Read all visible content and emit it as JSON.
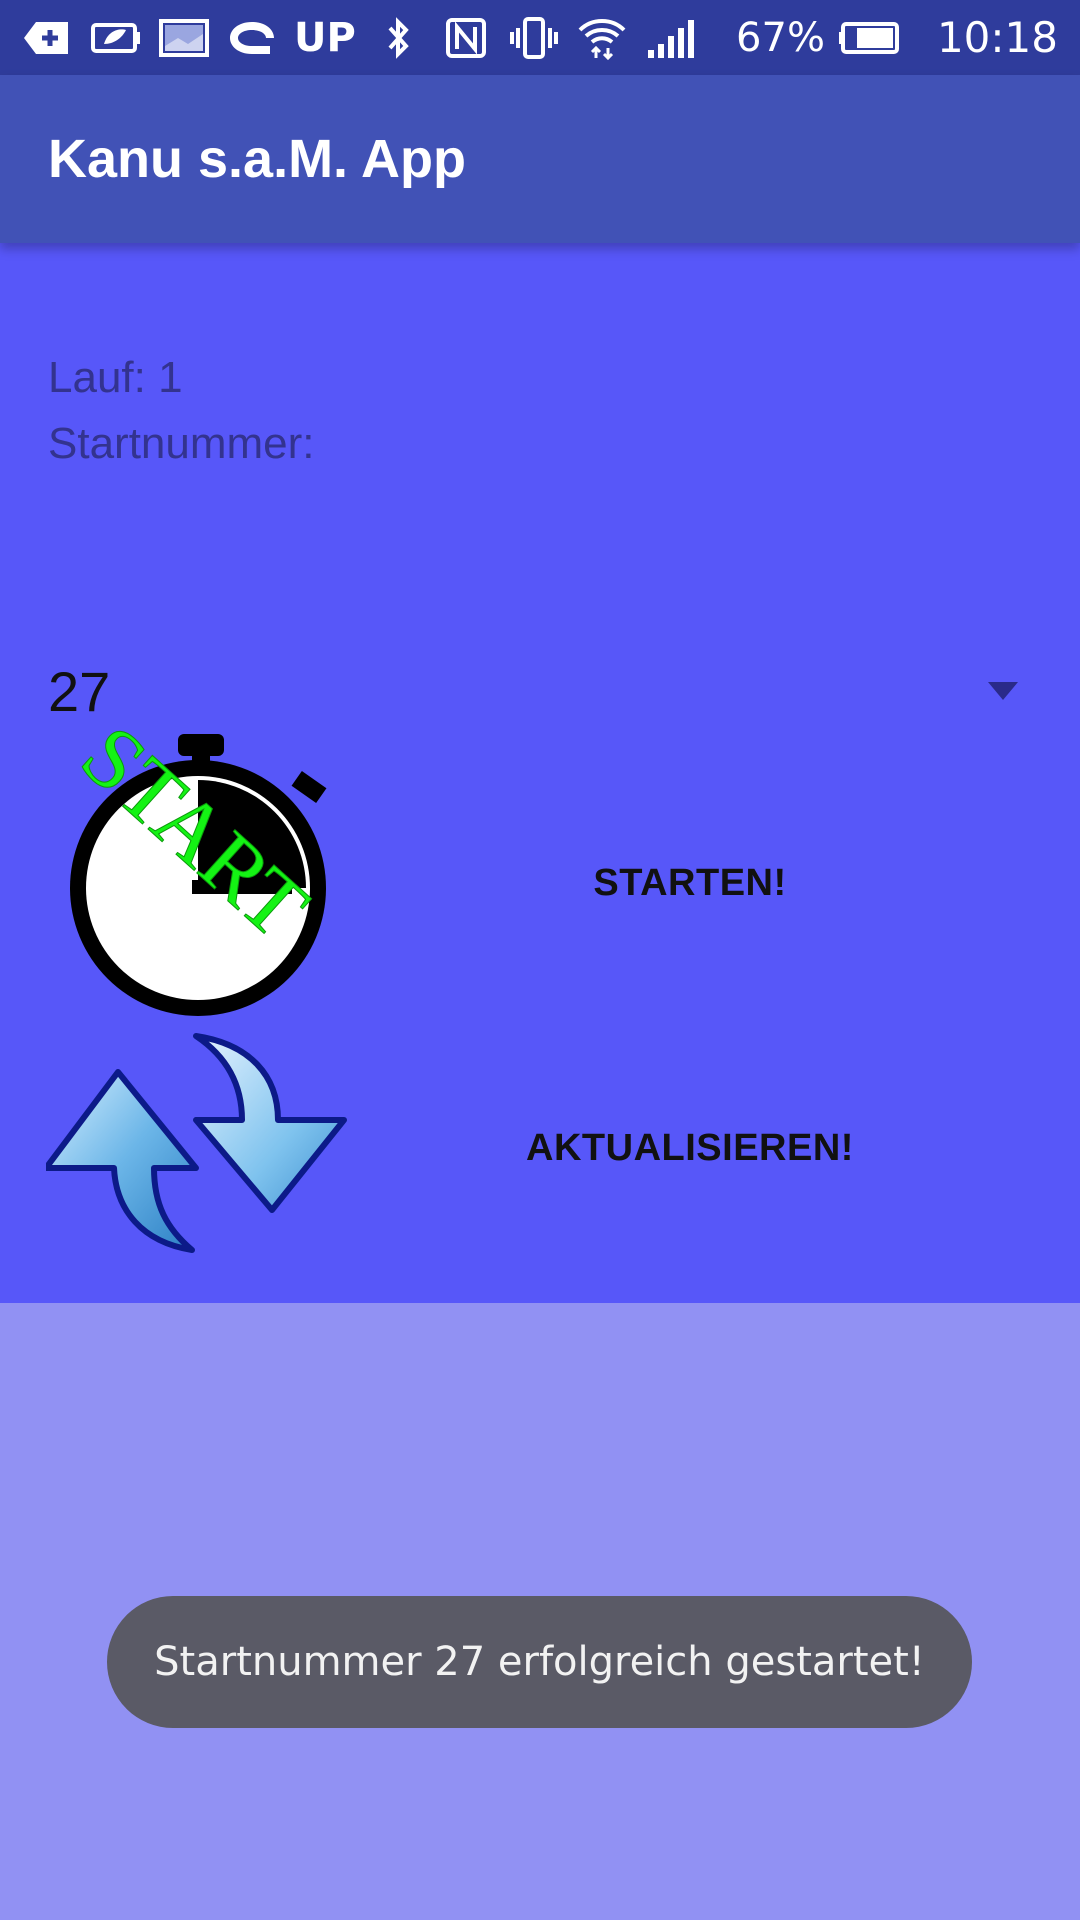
{
  "status_bar": {
    "icons": [
      "add-box-icon",
      "battery-saver-icon",
      "image-icon",
      "loop-icon",
      "bluetooth-icon",
      "nfc-icon",
      "vibrate-icon",
      "wifi-icon",
      "signal-icon",
      "battery-icon"
    ],
    "up_label": "UP",
    "battery_percent": "67%",
    "time": "10:18"
  },
  "app_bar": {
    "title": "Kanu s.a.M. App"
  },
  "info": {
    "lauf": "Lauf: 1",
    "startnummer_label": "Startnummer:"
  },
  "spinner": {
    "selected_value": "27"
  },
  "buttons": {
    "start_label": "STARTEN!",
    "refresh_label": "AKTUALISIEREN!"
  },
  "images": {
    "start_text": "START"
  },
  "toast": {
    "message": "Startnummer 27 erfolgreich gestartet!"
  },
  "colors": {
    "status_bar": "#2f3c9c",
    "app_bar": "#4152b6",
    "content_bg": "#5757f9",
    "page_bg": "#9191f3",
    "toast_bg": "#5a5a66",
    "start_text": "#14f314"
  }
}
